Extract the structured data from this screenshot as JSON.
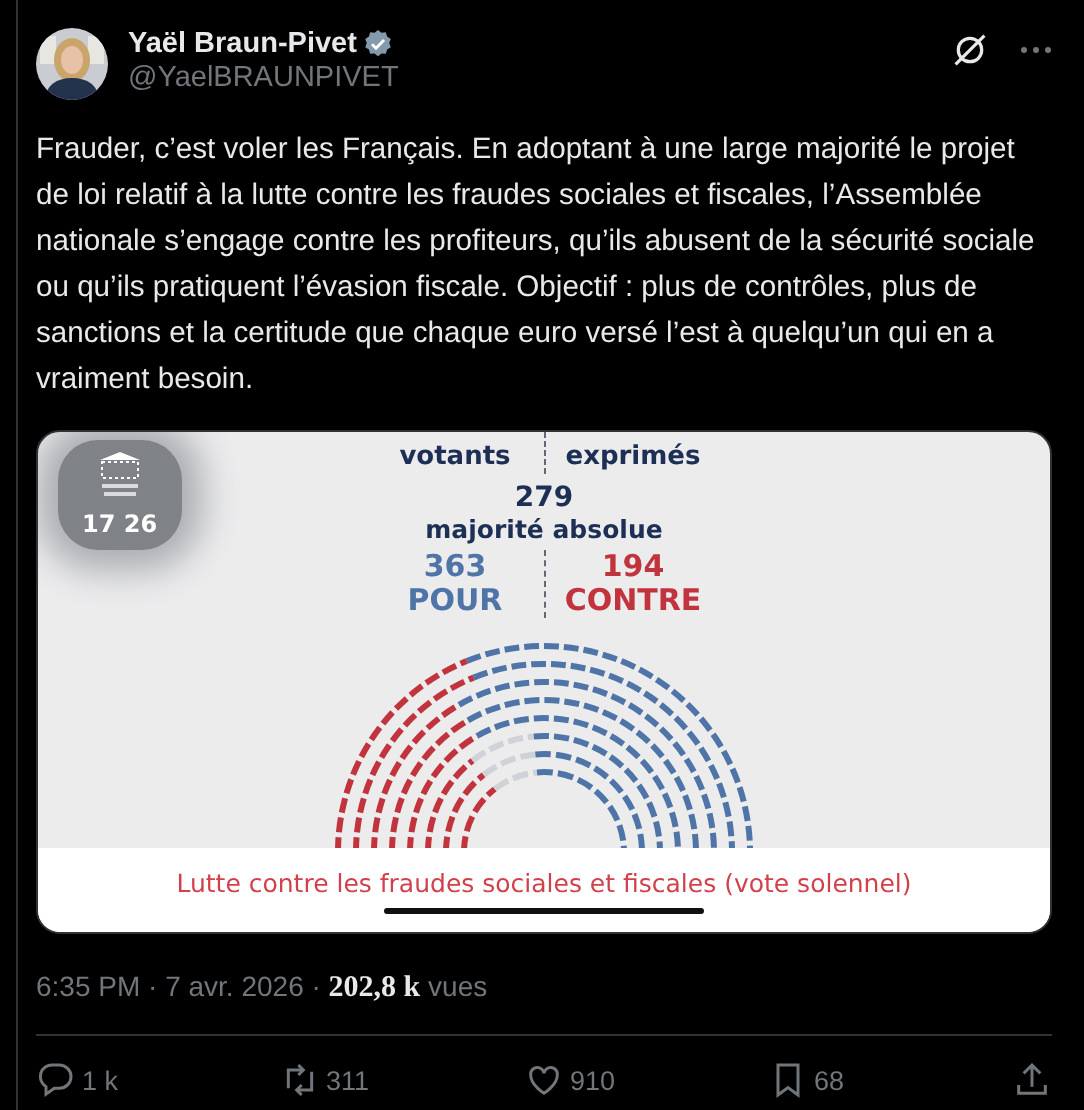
{
  "author": {
    "name": "Yaël Braun-Pivet",
    "handle": "@YaelBRAUNPIVET",
    "verified": true
  },
  "text": "Frauder, c’est voler les Français. En adoptant à une large majorité le projet de loi relatif à la lutte contre les fraudes sociales et fiscales, l’Assemblée nationale s’engage contre les profiteurs, qu’ils abusent de la sécurité sociale ou qu’ils pratiquent l’évasion fiscale. Objectif : plus de contrôles, plus de sanctions et la certitude que chaque euro versé l’est à quelqu’un qui en a vraiment besoin.",
  "media": {
    "logo_caption": "17 26",
    "stats": [
      {
        "label": "votants"
      },
      {
        "label": "exprimés"
      }
    ],
    "majority": {
      "value": "279",
      "label": "majorité absolue"
    },
    "results": [
      {
        "value": "363",
        "label": "POUR",
        "color": "#4f74a8"
      },
      {
        "value": "194",
        "label": "CONTRE",
        "color": "#c2343d"
      }
    ],
    "caption": "Lutte contre les fraudes sociales et fiscales (vote solennel)"
  },
  "meta": {
    "time": "6:35 PM · 7 avr. 2026 ·",
    "views": "202,8 k",
    "views_label": "vues"
  },
  "actions": [
    {
      "kind": "reply",
      "count": "1 k"
    },
    {
      "kind": "repost",
      "count": "311"
    },
    {
      "kind": "like",
      "count": "910"
    },
    {
      "kind": "bookmark",
      "count": "68"
    },
    {
      "kind": "share"
    }
  ]
}
